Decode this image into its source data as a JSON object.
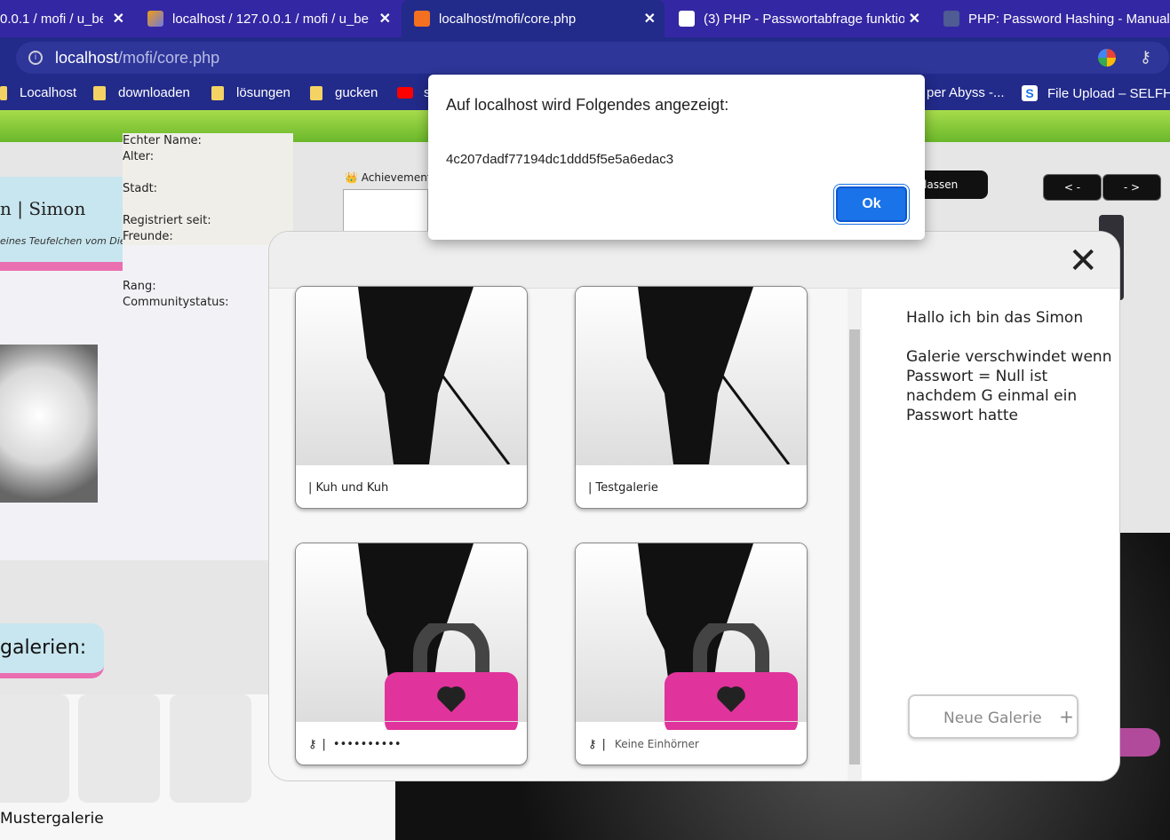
{
  "browser": {
    "tabs": [
      {
        "title": "0.0.1 / mofi / u_be"
      },
      {
        "title": "localhost / 127.0.0.1 / mofi / u_be"
      },
      {
        "title": "localhost/mofi/core.php"
      },
      {
        "title": "(3) PHP - Passwortabfrage funktio"
      },
      {
        "title": "PHP: Password Hashing - Manual"
      }
    ],
    "url_host": "localhost",
    "url_path": "/mofi/core.php",
    "bookmarks": [
      "Localhost",
      "downloaden",
      "lösungen",
      "gucken",
      "s",
      "per Abyss -...",
      "File Upload – SELFH..."
    ]
  },
  "profile": {
    "name": "n | Simon",
    "subtitle": "eines Teufelchen vom Dienst '",
    "fields": [
      "Echter Name:",
      "Alter:",
      "Stadt:",
      "Registriert seit:",
      "Freunde:",
      "Rang:",
      "Communitystatus:"
    ],
    "achievements": "Achievements",
    "galleries_heading": "galerien:",
    "muster_label": "Mustergalerie"
  },
  "page_nav": {
    "prev": "< -",
    "next": "- >",
    "hassen": "lassen"
  },
  "modal": {
    "close_symbol": "✕",
    "galleries": [
      {
        "label": "|  Kuh und Kuh",
        "locked": false
      },
      {
        "label": "|  Testgalerie",
        "locked": false
      },
      {
        "label": "••••••••••",
        "locked": true,
        "prefix": "|"
      },
      {
        "label": "Keine Einhörner",
        "locked": true,
        "prefix": "|"
      }
    ],
    "description_line1": "Hallo ich bin das Simon",
    "description_line2": "Galerie verschwindet wenn Passwort = Null ist nachdem G einmal ein Passwort hatte",
    "new_gallery_label": "Neue Galerie",
    "new_gallery_icon": "+"
  },
  "alert": {
    "title": "Auf localhost wird Folgendes angezeigt:",
    "message": "4c207dadf77194dc1ddd5f5e5a6edac3",
    "ok_label": "Ok"
  }
}
